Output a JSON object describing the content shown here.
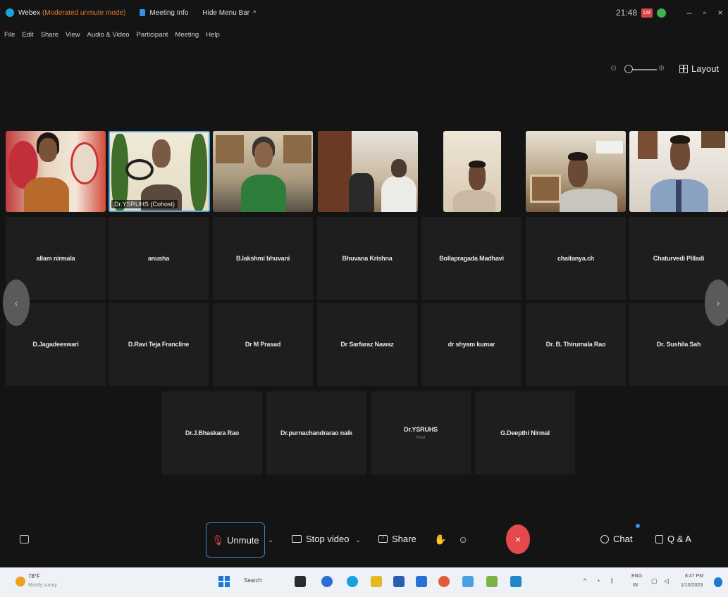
{
  "titlebar": {
    "app_name": "Webex",
    "mode": "(Moderated unmute mode)",
    "meeting_info": "Meeting Info",
    "hide_menu": "Hide Menu Bar",
    "caret": "^",
    "time": "21:48",
    "rec_badge": "LM",
    "minimize": "–",
    "restore": "▫",
    "close": "×"
  },
  "menu": [
    "File",
    "Edit",
    "Share",
    "View",
    "Audio & Video",
    "Participant",
    "Meeting",
    "Help"
  ],
  "layout": {
    "label": "Layout",
    "zoom_minus": "⊖",
    "zoom_plus": "⊕"
  },
  "videos": [
    {
      "name": "",
      "active": false
    },
    {
      "name": "Dr.YSRUHS (Cohost)",
      "active": true
    },
    {
      "name": "",
      "active": false
    },
    {
      "name": "",
      "active": false
    },
    {
      "name": "",
      "active": false
    },
    {
      "name": "",
      "active": false
    },
    {
      "name": "",
      "active": false
    }
  ],
  "participants_row1": [
    "allam nirmala",
    "anusha",
    "B.lakshmi bhuvani",
    "Bhuvana Krishna",
    "Bollapragada Madhavi",
    "chaitanya.ch",
    "Chaturvedi Pilladi"
  ],
  "participants_row2": [
    "D.Jagadeeswari",
    "D.Ravi Teja Francline",
    "Dr M Prasad",
    "Dr Sarfaraz Nawaz",
    "dr shyam kumar",
    "Dr. B. Thirumala Rao",
    "Dr. Sushila Sah"
  ],
  "participants_row3": [
    {
      "name": "Dr.J.Bhaskara Rao",
      "sub": ""
    },
    {
      "name": "Dr.purnachandrarao naik",
      "sub": ""
    },
    {
      "name": "Dr.YSRUHS",
      "sub": "Host"
    },
    {
      "name": "G.Deepthi Nirmal",
      "sub": ""
    }
  ],
  "nav": {
    "prev": "‹",
    "next": "›"
  },
  "toolbar": {
    "unmute": "Unmute",
    "stop_video": "Stop video",
    "share": "Share",
    "leave": "×",
    "chat": "Chat",
    "qa": "Q & A",
    "dropdown": "⌄"
  },
  "taskbar": {
    "temp": "78°F",
    "weather": "Mostly sunny",
    "search": "Search",
    "lang1": "ENG",
    "lang2": "IN",
    "time": "8:47 PM",
    "date": "1/10/2023",
    "app_colors": [
      "#2b2b2b",
      "#2a6fd6",
      "#1a9fe0",
      "#e8b820",
      "#2a5fb0",
      "#2a6fd6",
      "#e25b3a",
      "#4aa0e0",
      "#7cb342",
      "#1e88c8"
    ]
  }
}
